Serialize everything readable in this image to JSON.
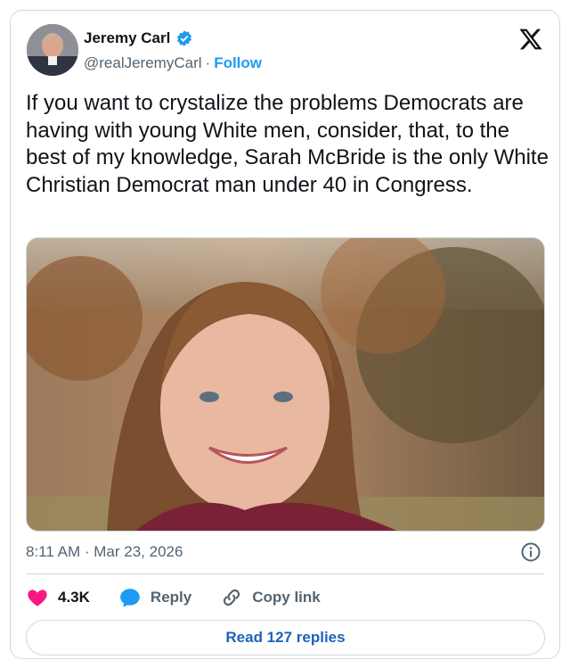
{
  "author": {
    "name": "Jeremy Carl",
    "handle": "@realJeremyCarl",
    "separator": "·",
    "follow_label": "Follow"
  },
  "tweet": {
    "text": "If you want to crystalize the problems Democrats are having with young White men, consider, that, to the best of my knowledge, Sarah McBride is the only White Christian Democrat man under 40 in Congress."
  },
  "meta": {
    "time": "8:11 AM",
    "separator": "·",
    "date": "Mar 23, 2026"
  },
  "actions": {
    "like_count": "4.3K",
    "reply_label": "Reply",
    "copy_label": "Copy link"
  },
  "read_replies": "Read 127 replies",
  "colors": {
    "accent": "#1d9bf0",
    "like": "#f91880",
    "text": "#0f1419",
    "muted": "#536471",
    "border": "#cfd9de"
  },
  "icons": [
    "verified-badge-icon",
    "x-logo-icon",
    "info-icon",
    "heart-icon",
    "reply-bubble-icon",
    "link-icon"
  ]
}
